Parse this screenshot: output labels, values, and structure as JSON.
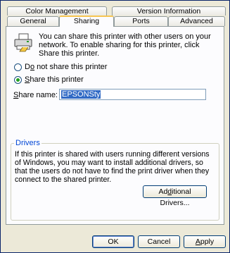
{
  "tabs": {
    "color_management": "Color Management",
    "version_information": "Version Information",
    "general": "General",
    "sharing": "Sharing",
    "ports": "Ports",
    "advanced": "Advanced"
  },
  "info_text": "You can share this printer with other users on your network.  To enable sharing for this printer, click Share this printer.",
  "options": {
    "do_not_share": {
      "pre": "D",
      "accel": "o",
      "post": " not share this printer"
    },
    "share": {
      "pre": "",
      "accel": "S",
      "post": "hare this printer"
    }
  },
  "share_name": {
    "label_accel": "S",
    "label_rest": "hare name:",
    "value": "EPSONSty"
  },
  "drivers": {
    "title": "Drivers",
    "text": "If this printer is shared with users running different versions of Windows, you may want to install additional drivers, so that the users do not have to find the print driver when they connect to the shared printer.",
    "button": {
      "pre": "Ad",
      "accel": "d",
      "post": "itional Drivers..."
    }
  },
  "buttons": {
    "ok": "OK",
    "cancel": "Cancel",
    "apply_accel": "A",
    "apply_rest": "pply"
  }
}
